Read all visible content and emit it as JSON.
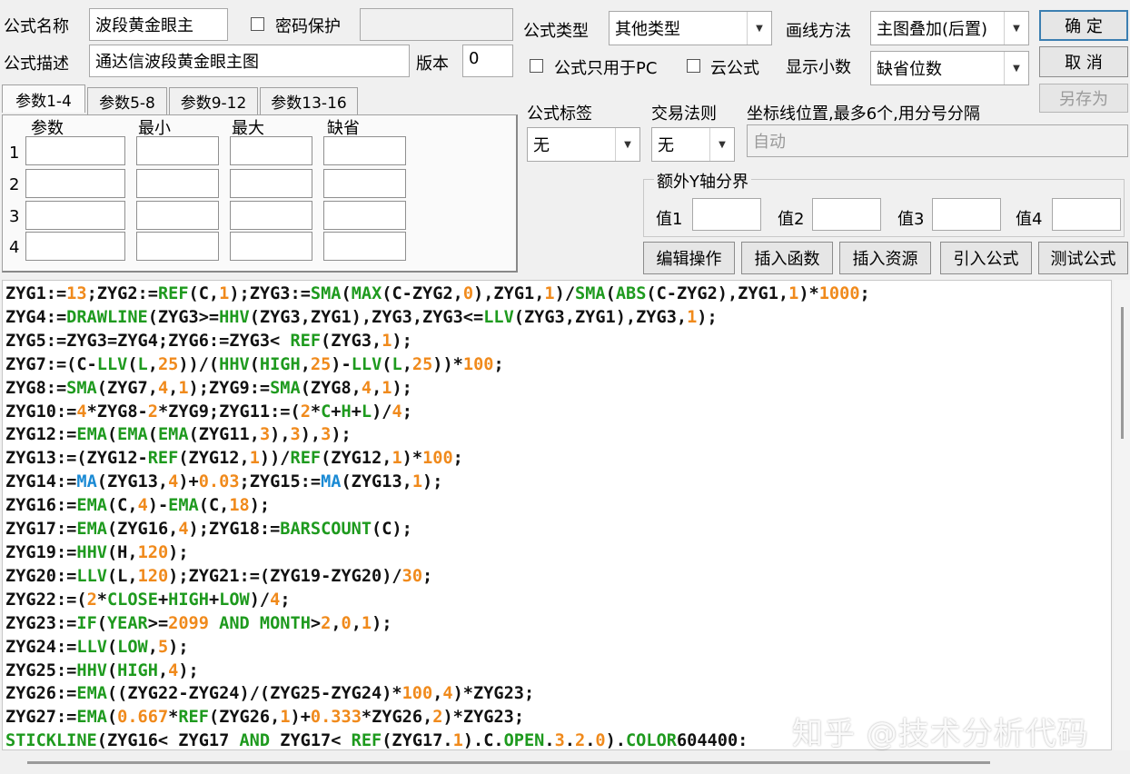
{
  "header": {
    "name_label": "公式名称",
    "name_value": "波段黄金眼主",
    "password_label": "密码保护",
    "password_value": "",
    "desc_label": "公式描述",
    "desc_value": "通达信波段黄金眼主图",
    "version_label": "版本",
    "version_value": "0"
  },
  "options": {
    "type_label": "公式类型",
    "type_value": "其他类型",
    "draw_label": "画线方法",
    "draw_value": "主图叠加(后置)",
    "pc_only_label": "公式只用于PC",
    "cloud_label": "云公式",
    "decimals_label": "显示小数",
    "decimals_value": "缺省位数",
    "tag_label": "公式标签",
    "tag_value": "无",
    "rule_label": "交易法则",
    "rule_value": "无",
    "coord_label": "坐标线位置,最多6个,用分号分隔",
    "coord_value": "自动",
    "yaxis_label": "额外Y轴分界",
    "val_labels": [
      "值1",
      "值2",
      "值3",
      "值4"
    ]
  },
  "buttons": {
    "ok": "确  定",
    "cancel": "取  消",
    "save_as": "另存为",
    "edit": "编辑操作",
    "insert_func": "插入函数",
    "insert_res": "插入资源",
    "import": "引入公式",
    "test": "测试公式"
  },
  "params": {
    "tabs": [
      "参数1-4",
      "参数5-8",
      "参数9-12",
      "参数13-16"
    ],
    "headers": [
      "参数",
      "最小",
      "最大",
      "缺省"
    ],
    "rows": [
      "1",
      "2",
      "3",
      "4"
    ]
  },
  "code_lines": [
    [
      [
        "ZYG1:=",
        ""
      ],
      [
        "13",
        "n"
      ],
      [
        ";ZYG2:=",
        ""
      ],
      [
        "REF",
        "f"
      ],
      [
        "(C,",
        ""
      ],
      [
        "1",
        "n"
      ],
      [
        ");ZYG3:=",
        ""
      ],
      [
        "SMA",
        "f"
      ],
      [
        "(",
        ""
      ],
      [
        "MAX",
        "f"
      ],
      [
        "(C-ZYG2,",
        ""
      ],
      [
        "0",
        "n"
      ],
      [
        "),ZYG1,",
        ""
      ],
      [
        "1",
        "n"
      ],
      [
        ")/",
        ""
      ],
      [
        "SMA",
        "f"
      ],
      [
        "(",
        ""
      ],
      [
        "ABS",
        "f"
      ],
      [
        "(C-ZYG2),ZYG1,",
        ""
      ],
      [
        "1",
        "n"
      ],
      [
        ")*",
        ""
      ],
      [
        "1000",
        "n"
      ],
      [
        ";",
        ""
      ]
    ],
    [
      [
        "ZYG4:=",
        ""
      ],
      [
        "DRAWLINE",
        "f"
      ],
      [
        "(ZYG3>=",
        ""
      ],
      [
        "HHV",
        "f"
      ],
      [
        "(ZYG3,ZYG1),ZYG3,ZYG3<=",
        ""
      ],
      [
        "LLV",
        "f"
      ],
      [
        "(ZYG3,ZYG1),ZYG3,",
        ""
      ],
      [
        "1",
        "n"
      ],
      [
        ");",
        ""
      ]
    ],
    [
      [
        "ZYG5:=ZYG3=ZYG4;ZYG6:=ZYG3< ",
        ""
      ],
      [
        "REF",
        "f"
      ],
      [
        "(ZYG3,",
        ""
      ],
      [
        "1",
        "n"
      ],
      [
        ");",
        ""
      ]
    ],
    [
      [
        "ZYG7:=(C-",
        ""
      ],
      [
        "LLV",
        "f"
      ],
      [
        "(",
        ""
      ],
      [
        "L",
        "f"
      ],
      [
        ",",
        ""
      ],
      [
        "25",
        "n"
      ],
      [
        "))/(",
        ""
      ],
      [
        "HHV",
        "f"
      ],
      [
        "(",
        ""
      ],
      [
        "HIGH",
        "f"
      ],
      [
        ",",
        ""
      ],
      [
        "25",
        "n"
      ],
      [
        ")-",
        ""
      ],
      [
        "LLV",
        "f"
      ],
      [
        "(",
        ""
      ],
      [
        "L",
        "f"
      ],
      [
        ",",
        ""
      ],
      [
        "25",
        "n"
      ],
      [
        "))*",
        ""
      ],
      [
        "100",
        "n"
      ],
      [
        ";",
        ""
      ]
    ],
    [
      [
        "ZYG8:=",
        ""
      ],
      [
        "SMA",
        "f"
      ],
      [
        "(ZYG7,",
        ""
      ],
      [
        "4",
        "n"
      ],
      [
        ",",
        ""
      ],
      [
        "1",
        "n"
      ],
      [
        ");ZYG9:=",
        ""
      ],
      [
        "SMA",
        "f"
      ],
      [
        "(ZYG8,",
        ""
      ],
      [
        "4",
        "n"
      ],
      [
        ",",
        ""
      ],
      [
        "1",
        "n"
      ],
      [
        ");",
        ""
      ]
    ],
    [
      [
        "ZYG10:=",
        ""
      ],
      [
        "4",
        "n"
      ],
      [
        "*ZYG8-",
        ""
      ],
      [
        "2",
        "n"
      ],
      [
        "*ZYG9;ZYG11:=(",
        ""
      ],
      [
        "2",
        "n"
      ],
      [
        "*",
        ""
      ],
      [
        "C",
        "f"
      ],
      [
        "+",
        ""
      ],
      [
        "H",
        "f"
      ],
      [
        "+",
        ""
      ],
      [
        "L",
        "f"
      ],
      [
        ")/",
        ""
      ],
      [
        "4",
        "n"
      ],
      [
        ";",
        ""
      ]
    ],
    [
      [
        "ZYG12:=",
        ""
      ],
      [
        "EMA",
        "f"
      ],
      [
        "(",
        ""
      ],
      [
        "EMA",
        "f"
      ],
      [
        "(",
        ""
      ],
      [
        "EMA",
        "f"
      ],
      [
        "(ZYG11,",
        ""
      ],
      [
        "3",
        "n"
      ],
      [
        "),",
        ""
      ],
      [
        "3",
        "n"
      ],
      [
        "),",
        ""
      ],
      [
        "3",
        "n"
      ],
      [
        ");",
        ""
      ]
    ],
    [
      [
        "ZYG13:=(ZYG12-",
        ""
      ],
      [
        "REF",
        "f"
      ],
      [
        "(ZYG12,",
        ""
      ],
      [
        "1",
        "n"
      ],
      [
        "))/",
        ""
      ],
      [
        "REF",
        "f"
      ],
      [
        "(ZYG12,",
        ""
      ],
      [
        "1",
        "n"
      ],
      [
        ")*",
        ""
      ],
      [
        "100",
        "n"
      ],
      [
        ";",
        ""
      ]
    ],
    [
      [
        "ZYG14:=",
        ""
      ],
      [
        "MA",
        "b"
      ],
      [
        "(ZYG13,",
        ""
      ],
      [
        "4",
        "n"
      ],
      [
        ")+",
        ""
      ],
      [
        "0.03",
        "n"
      ],
      [
        ";ZYG15:=",
        ""
      ],
      [
        "MA",
        "b"
      ],
      [
        "(ZYG13,",
        ""
      ],
      [
        "1",
        "n"
      ],
      [
        ");",
        ""
      ]
    ],
    [
      [
        "ZYG16:=",
        ""
      ],
      [
        "EMA",
        "f"
      ],
      [
        "(C,",
        ""
      ],
      [
        "4",
        "n"
      ],
      [
        ")-",
        ""
      ],
      [
        "EMA",
        "f"
      ],
      [
        "(C,",
        ""
      ],
      [
        "18",
        "n"
      ],
      [
        ");",
        ""
      ]
    ],
    [
      [
        "ZYG17:=",
        ""
      ],
      [
        "EMA",
        "f"
      ],
      [
        "(ZYG16,",
        ""
      ],
      [
        "4",
        "n"
      ],
      [
        ");ZYG18:=",
        ""
      ],
      [
        "BARSCOUNT",
        "f"
      ],
      [
        "(C);",
        ""
      ]
    ],
    [
      [
        "ZYG19:=",
        ""
      ],
      [
        "HHV",
        "f"
      ],
      [
        "(H,",
        ""
      ],
      [
        "120",
        "n"
      ],
      [
        ");",
        ""
      ]
    ],
    [
      [
        "ZYG20:=",
        ""
      ],
      [
        "LLV",
        "f"
      ],
      [
        "(L,",
        ""
      ],
      [
        "120",
        "n"
      ],
      [
        ");ZYG21:=(ZYG19-ZYG20)/",
        ""
      ],
      [
        "30",
        "n"
      ],
      [
        ";",
        ""
      ]
    ],
    [
      [
        "ZYG22:=(",
        ""
      ],
      [
        "2",
        "n"
      ],
      [
        "*",
        ""
      ],
      [
        "CLOSE",
        "f"
      ],
      [
        "+",
        ""
      ],
      [
        "HIGH",
        "f"
      ],
      [
        "+",
        ""
      ],
      [
        "LOW",
        "f"
      ],
      [
        ")/",
        ""
      ],
      [
        "4",
        "n"
      ],
      [
        ";",
        ""
      ]
    ],
    [
      [
        "ZYG23:=",
        ""
      ],
      [
        "IF",
        "f"
      ],
      [
        "(",
        ""
      ],
      [
        "YEAR",
        "f"
      ],
      [
        ">=",
        ""
      ],
      [
        "2099",
        "n"
      ],
      [
        " ",
        ""
      ],
      [
        "AND",
        "f"
      ],
      [
        " ",
        ""
      ],
      [
        "MONTH",
        "f"
      ],
      [
        ">",
        ""
      ],
      [
        "2",
        "n"
      ],
      [
        ",",
        ""
      ],
      [
        "0",
        "n"
      ],
      [
        ",",
        ""
      ],
      [
        "1",
        "n"
      ],
      [
        ");",
        ""
      ]
    ],
    [
      [
        "ZYG24:=",
        ""
      ],
      [
        "LLV",
        "f"
      ],
      [
        "(",
        ""
      ],
      [
        "LOW",
        "f"
      ],
      [
        ",",
        ""
      ],
      [
        "5",
        "n"
      ],
      [
        ");",
        ""
      ]
    ],
    [
      [
        "ZYG25:=",
        ""
      ],
      [
        "HHV",
        "f"
      ],
      [
        "(",
        ""
      ],
      [
        "HIGH",
        "f"
      ],
      [
        ",",
        ""
      ],
      [
        "4",
        "n"
      ],
      [
        ");",
        ""
      ]
    ],
    [
      [
        "ZYG26:=",
        ""
      ],
      [
        "EMA",
        "f"
      ],
      [
        "((ZYG22-ZYG24)/(ZYG25-ZYG24)*",
        ""
      ],
      [
        "100",
        "n"
      ],
      [
        ",",
        ""
      ],
      [
        "4",
        "n"
      ],
      [
        ")*ZYG23;",
        ""
      ]
    ],
    [
      [
        "ZYG27:=",
        ""
      ],
      [
        "EMA",
        "f"
      ],
      [
        "(",
        ""
      ],
      [
        "0.667",
        "n"
      ],
      [
        "*",
        ""
      ],
      [
        "REF",
        "f"
      ],
      [
        "(ZYG26,",
        ""
      ],
      [
        "1",
        "n"
      ],
      [
        ")+",
        ""
      ],
      [
        "0.333",
        "n"
      ],
      [
        "*ZYG26,",
        ""
      ],
      [
        "2",
        "n"
      ],
      [
        ")*ZYG23;",
        ""
      ]
    ],
    [
      [
        "STICKLINE",
        "f"
      ],
      [
        "(ZYG16< ZYG17 ",
        ""
      ],
      [
        "AND",
        "f"
      ],
      [
        " ZYG17< ",
        ""
      ],
      [
        "REF",
        "f"
      ],
      [
        "(ZYG17.",
        ""
      ],
      [
        "1",
        "n"
      ],
      [
        ").C.",
        ""
      ],
      [
        "OPEN",
        "f"
      ],
      [
        ".",
        ""
      ],
      [
        "3",
        "n"
      ],
      [
        ".",
        ""
      ],
      [
        "2",
        "n"
      ],
      [
        ".",
        ""
      ],
      [
        "0",
        "n"
      ],
      [
        ").",
        ""
      ],
      [
        "COLOR",
        "f"
      ],
      [
        "604400",
        ""
      ],
      [
        ":",
        ""
      ]
    ]
  ],
  "watermark": "知乎 @技术分析代码",
  "colors": {
    "function": "#1e9a1e",
    "number": "#f08a1c",
    "blue_func": "#1a8ad4",
    "text": "#111111"
  }
}
